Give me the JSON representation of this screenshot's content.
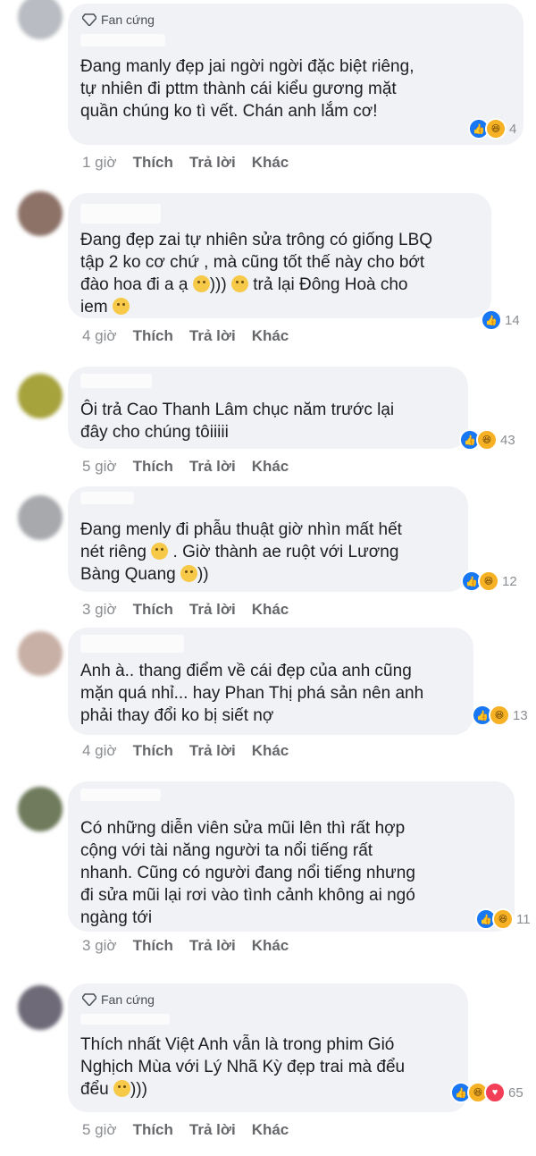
{
  "comments": [
    {
      "badge": "Fan cứng",
      "text": "Đang manly đẹp jai ngời ngời đặc biệt riêng,\ntự nhiên đi pttm thành cái kiểu gương mặt\nquần chúng ko tì vết. Chán anh lắm cơ!",
      "count": "4",
      "time": "1 giờ",
      "like": "Thích",
      "reply": "Trả lời",
      "more": "Khác"
    },
    {
      "badge": "",
      "text": "Đang đẹp zai tự nhiên sửa trông có giống LBQ\ntập 2 ko cơ chứ , mà cũng tốt thế này cho bớt\nđào hoa đi a ạ",
      "text2": "))) ",
      "text3": " trả lại Đông Hoà cho\niem ",
      "count": "14",
      "time": "4 giờ",
      "like": "Thích",
      "reply": "Trả lời",
      "more": "Khác"
    },
    {
      "badge": "",
      "text": "Ôi trả Cao Thanh Lâm chục năm trước lại\nđây cho chúng tôiiiii",
      "count": "43",
      "time": "5 giờ",
      "like": "Thích",
      "reply": "Trả lời",
      "more": "Khác"
    },
    {
      "badge": "",
      "text": "Đang menly đi phẫu thuật giờ nhìn mất hết\nnét riêng ",
      "text2": " . Giờ thành ae ruột với Lương\nBàng Quang ",
      "text3": "))",
      "count": "12",
      "time": "3 giờ",
      "like": "Thích",
      "reply": "Trả lời",
      "more": "Khác"
    },
    {
      "badge": "",
      "text": "Anh à.. thang điểm về cái đẹp của anh cũng\nmặn quá nhỉ... hay Phan Thị phá sản nên anh\nphải thay đổi ko bị siết nợ",
      "count": "13",
      "time": "4 giờ",
      "like": "Thích",
      "reply": "Trả lời",
      "more": "Khác"
    },
    {
      "badge": "",
      "text": "Có những diễn viên sửa mũi lên thì rất hợp\ncộng với tài năng người ta nổi tiếng rất\nnhanh. Cũng có người đang nổi tiếng nhưng\nđi sửa mũi lại rơi vào tình cảnh không ai ngó\nngàng tới",
      "count": "11",
      "time": "3 giờ",
      "like": "Thích",
      "reply": "Trả lời",
      "more": "Khác"
    },
    {
      "badge": "Fan cứng",
      "text": "Thích nhất Việt Anh vẫn là trong phim Gió\nNghịch Mùa với Lý Nhã Kỳ đẹp trai mà đểu\nđểu ",
      "text2": ")))",
      "count": "65",
      "time": "5 giờ",
      "like": "Thích",
      "reply": "Trả lời",
      "more": "Khác"
    }
  ],
  "colors": {
    "like": "#1877f2",
    "haha": "#f7b125",
    "love": "#f33e58",
    "bubble": "#f0f2f5"
  }
}
